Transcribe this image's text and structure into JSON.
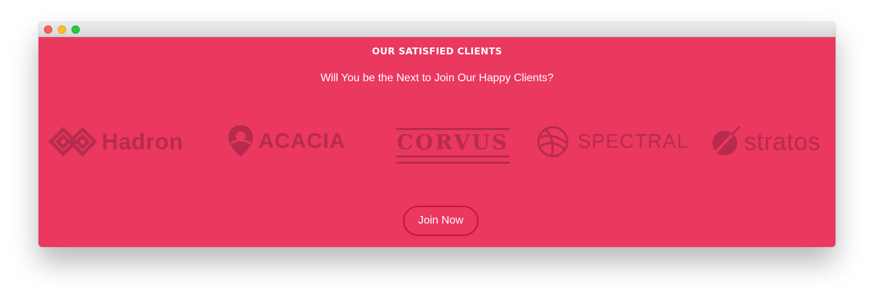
{
  "colors": {
    "background": "#ea385e",
    "logo": "#b72b4e",
    "button_border": "#c2153f",
    "text": "#ffffff"
  },
  "section": {
    "heading": "OUR SATISFIED CLIENTS",
    "subheading": "Will You be the Next to Join Our Happy Clients?"
  },
  "logos": [
    {
      "name": "Hadron",
      "icon": "diamond-chain-icon"
    },
    {
      "name": "ACACIA",
      "icon": "location-pin-icon"
    },
    {
      "name": "CORVUS",
      "icon": "none"
    },
    {
      "name": "SPECTRAL",
      "icon": "globe-arc-icon"
    },
    {
      "name": "stratos",
      "icon": "circle-slash-icon"
    }
  ],
  "cta": {
    "label": "Join Now"
  }
}
